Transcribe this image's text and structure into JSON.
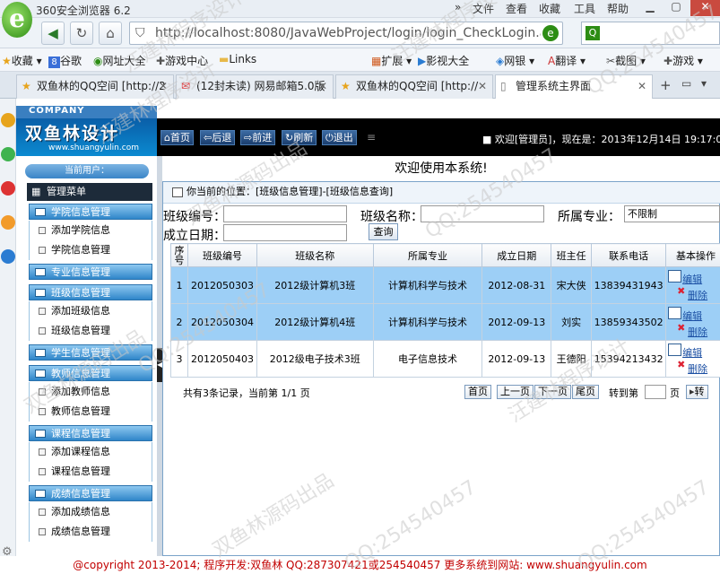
{
  "browser": {
    "title": "360安全浏览器 6.2",
    "menus": [
      "»",
      "文件",
      "查看",
      "收藏",
      "工具",
      "帮助"
    ],
    "address": "http://localhost:8080/JavaWebProject/login/login_CheckLogin.a",
    "bookmarks": [
      "收藏",
      "谷歌",
      "网址大全",
      "游戏中心",
      "Links",
      "扩展",
      "影视大全",
      "网银",
      "翻译",
      "截图",
      "游戏"
    ],
    "tabs": [
      "双鱼林的QQ空间 [http://2",
      "(12封未读) 网易邮箱5.0版",
      "双鱼林的QQ空间 [http://",
      "管理系统主界面"
    ]
  },
  "app": {
    "company": "COMPANY",
    "logo_text": "双鱼林设计",
    "logo_url": "www.shuangyulin.com",
    "nav": [
      "首页",
      "后退",
      "前进",
      "刷新",
      "退出"
    ],
    "welcome_top": "欢迎[管理员]，现在是：2013年12月14日 19:17:05",
    "current_user": "当前用户：",
    "manage_menu": "管理菜单",
    "welcome": "欢迎使用本系统!",
    "breadcrumb": "你当前的位置：[班级信息管理]-[班级信息查询]",
    "search": {
      "class_no_label": "班级编号：",
      "class_name_label": "班级名称：",
      "major_label": "所属专业：",
      "major_value": "不限制",
      "date_label": "成立日期：",
      "query_button": "查询"
    },
    "table": {
      "headers": [
        "序号",
        "班级编号",
        "班级名称",
        "所属专业",
        "成立日期",
        "班主任",
        "联系电话",
        "基本操作"
      ],
      "rows": [
        [
          "1",
          "2012050303",
          "2012级计算机3班",
          "计算机科学与技术",
          "2012-08-31",
          "宋大侠",
          "13839431943"
        ],
        [
          "2",
          "2012050304",
          "2012级计算机4班",
          "计算机科学与技术",
          "2012-09-13",
          "刘实",
          "13859343502"
        ],
        [
          "3",
          "2012050403",
          "2012级电子技术3班",
          "电子信息技术",
          "2012-09-13",
          "王德阳",
          "15394213432"
        ]
      ],
      "edit": "编辑",
      "delete": "删除"
    },
    "pager": {
      "summary": "共有3条记录，当前第 1/1 页",
      "first": "首页",
      "prev": "上一页",
      "next": "下一页",
      "last": "尾页",
      "goto": "转到第",
      "page_unit": "页",
      "go": "转"
    },
    "footer": "@copyright 2013-2014; 程序开发:双鱼林  QQ:287307421或254540457  更多系统到网站: www.shuangyulin.com"
  },
  "sidebar": [
    {
      "group": "学院信息管理",
      "items": [
        "添加学院信息",
        "学院信息管理"
      ]
    },
    {
      "group": "专业信息管理",
      "items": []
    },
    {
      "group": "班级信息管理",
      "items": [
        "添加班级信息",
        "班级信息管理"
      ]
    },
    {
      "group": "学生信息管理",
      "items": []
    },
    {
      "group": "教师信息管理",
      "items": [
        "添加教师信息",
        "教师信息管理"
      ]
    },
    {
      "group": "课程信息管理",
      "items": [
        "添加课程信息",
        "课程信息管理"
      ]
    },
    {
      "group": "成绩信息管理",
      "items": [
        "添加成绩信息",
        "成绩信息管理"
      ]
    }
  ],
  "watermarks": [
    "汪建林程序设计",
    "QQ:254540457",
    "双鱼林源码出品"
  ],
  "colors": {
    "selected_row": "#9dcff6",
    "topnav": "#000000",
    "group_header": "#2f86c9",
    "footer_text": "#c20000"
  }
}
